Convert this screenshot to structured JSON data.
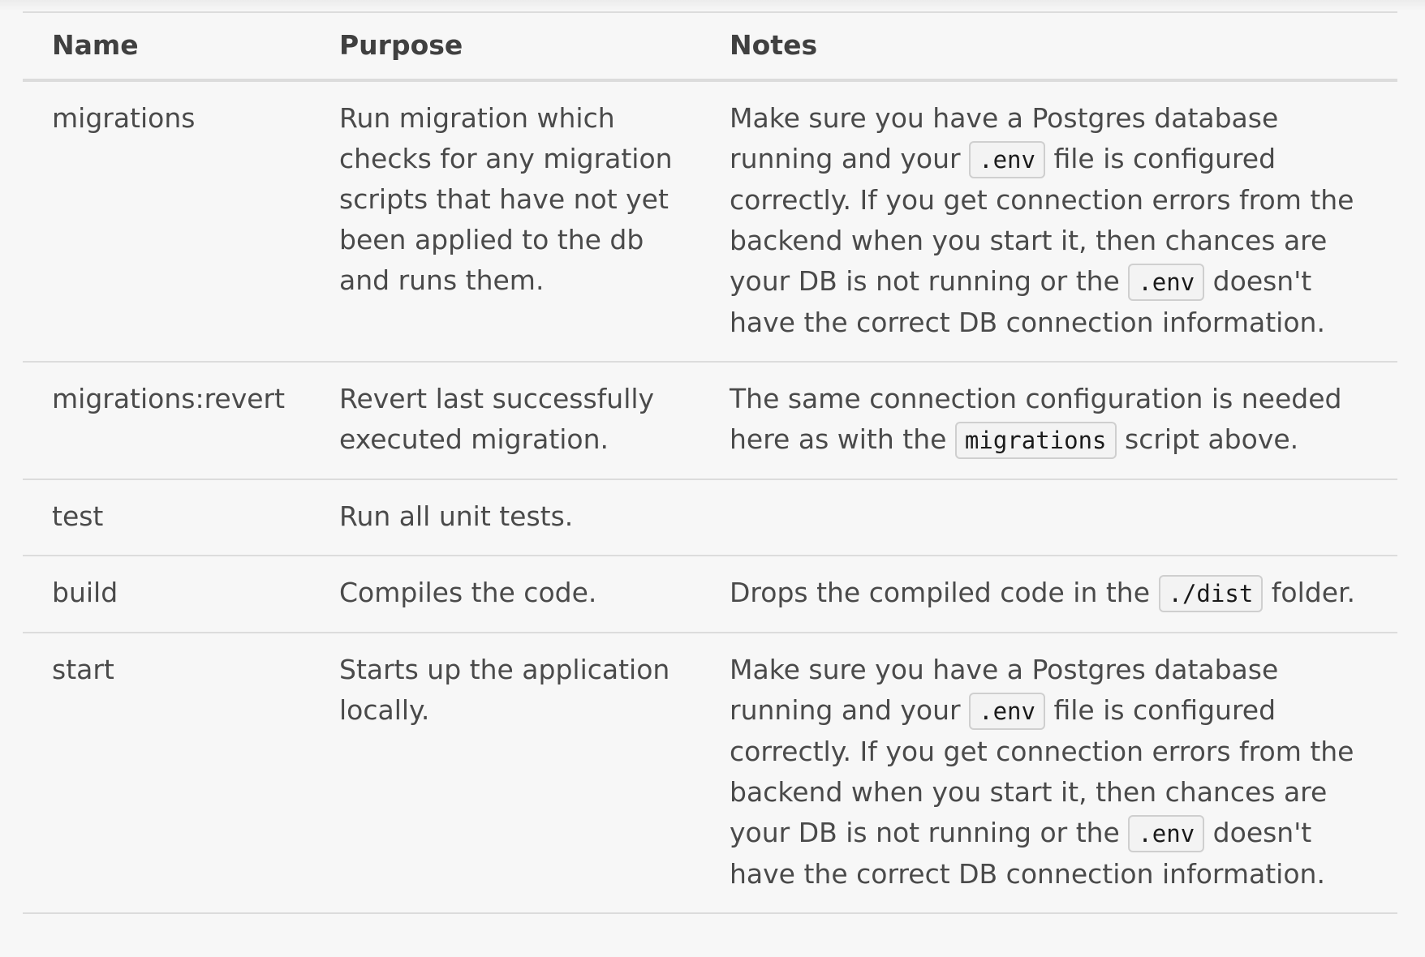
{
  "table": {
    "headers": [
      "Name",
      "Purpose",
      "Notes"
    ],
    "rows": [
      {
        "name": "migrations",
        "purpose": "Run migration which checks for any migration scripts that have not yet been applied to the db and runs them.",
        "notes": {
          "t1": "Make sure you have a Postgres database running and your ",
          "c1": ".env",
          "t2": " file is configured correctly. If you get connection errors from the backend when you start it, then chances are your DB is not running or the ",
          "c2": ".env",
          "t3": " doesn't have the correct DB connection information."
        }
      },
      {
        "name": "migrations:revert",
        "purpose": "Revert last successfully executed migration.",
        "notes": {
          "t1": "The same connection configuration is needed here as with the ",
          "c1": "migrations",
          "t2": " script above."
        }
      },
      {
        "name": "test",
        "purpose": "Run all unit tests.",
        "notes": {}
      },
      {
        "name": "build",
        "purpose": "Compiles the code.",
        "notes": {
          "t1": "Drops the compiled code in the ",
          "c1": "./dist",
          "t2": " folder."
        }
      },
      {
        "name": "start",
        "purpose": "Starts up the application locally.",
        "notes": {
          "t1": "Make sure you have a Postgres database running and your ",
          "c1": ".env",
          "t2": " file is configured correctly. If you get connection errors from the backend when you start it, then chances are your DB is not running or the ",
          "c2": ".env",
          "t3": " doesn't have the correct DB connection information."
        }
      }
    ]
  }
}
